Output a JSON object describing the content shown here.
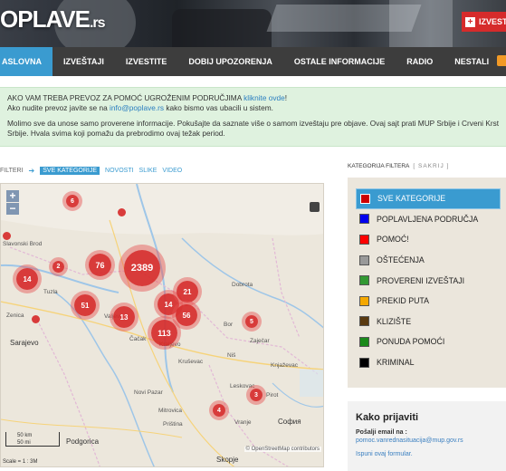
{
  "header": {
    "logo_text": "OPLAVE",
    "logo_tld": ".rs",
    "report_button": "IZVEST"
  },
  "nav": {
    "items": [
      "ASLOVNA",
      "IZVEŠTAJI",
      "IZVESTITE",
      "DOBIJ UPOZORENJA",
      "OSTALE INFORMACIJE",
      "RADIO",
      "NESTALI"
    ]
  },
  "notice": {
    "line1_a": "AKO VAM TREBA PREVOZ ZA POMOĆ UGROŽENIM PODRUČJIMA ",
    "line1_link": "kliknite ovde",
    "line1_b": "!",
    "line2_a": "Ako nudite prevoz javite se na ",
    "line2_link": "info@poplave.rs",
    "line2_b": " kako bismo vas ubacili u sistem.",
    "para2": "Molimo sve da unose samo proverene informacije. Pokušajte da saznate više o samom izveštaju pre objave. Ovaj sajt prati MUP Srbije i Crveni Krst Srbije. Hvala svima koji pomažu da prebrodimo ovaj težak period."
  },
  "filters": {
    "label": "FILTERI",
    "active": "SVE KATEGORIJE",
    "links": [
      "NOVOSTI",
      "SLIKE",
      "VIDEO"
    ]
  },
  "map": {
    "clusters": [
      {
        "label": "6"
      },
      {
        "label": "76"
      },
      {
        "label": "2389"
      },
      {
        "label": "14"
      },
      {
        "label": "2"
      },
      {
        "label": "51"
      },
      {
        "label": "13"
      },
      {
        "label": "14"
      },
      {
        "label": "21"
      },
      {
        "label": "56"
      },
      {
        "label": "113"
      },
      {
        "label": "5"
      },
      {
        "label": "3"
      },
      {
        "label": "4"
      }
    ],
    "labels": [
      "Slavonski Brod",
      "Tuzla",
      "Zenica",
      "Sarajevo",
      "Valjevo",
      "Čačak",
      "Kraljevo",
      "Kruševac",
      "Niš",
      "Bor",
      "Zaječar",
      "Novi Pazar",
      "Mitrovica",
      "Priština",
      "Leskovac",
      "Vranje",
      "Podgorica",
      "Skopje",
      "София",
      "Dobrota",
      "Knjaževac",
      "Pirot"
    ],
    "scale_km": "50 km",
    "scale_mi": "50 mi",
    "scale_text": "Scale = 1 : 3M",
    "attribution": "© OpenStreetMap contributors"
  },
  "panel": {
    "title": "KATEGORIJA FILTERA",
    "toggle": "[ SAKRIJ ]",
    "categories": [
      {
        "label": "SVE KATEGORIJE",
        "color": "#cc0000"
      },
      {
        "label": "POPLAVLJENA PODRUČJA",
        "color": "#0000ee"
      },
      {
        "label": "POMOĆ!",
        "color": "#ff0000"
      },
      {
        "label": "OŠTEĆENJA",
        "color": "#999999"
      },
      {
        "label": "PROVERENI IZVEŠTAJI",
        "color": "#339933"
      },
      {
        "label": "PREKID PUTA",
        "color": "#f5a800"
      },
      {
        "label": "KLIZIŠTE",
        "color": "#5a3a10"
      },
      {
        "label": "PONUDA POMOĆI",
        "color": "#1a8a1a"
      },
      {
        "label": "KRIMINAL",
        "color": "#000000"
      }
    ]
  },
  "howto": {
    "title": "Kako prijaviti",
    "email_label": "Pošalji email na :",
    "email": "pomoc.vanrednasituacija@mup.gov.rs",
    "form_link": "Ispuni ovaj formular."
  }
}
